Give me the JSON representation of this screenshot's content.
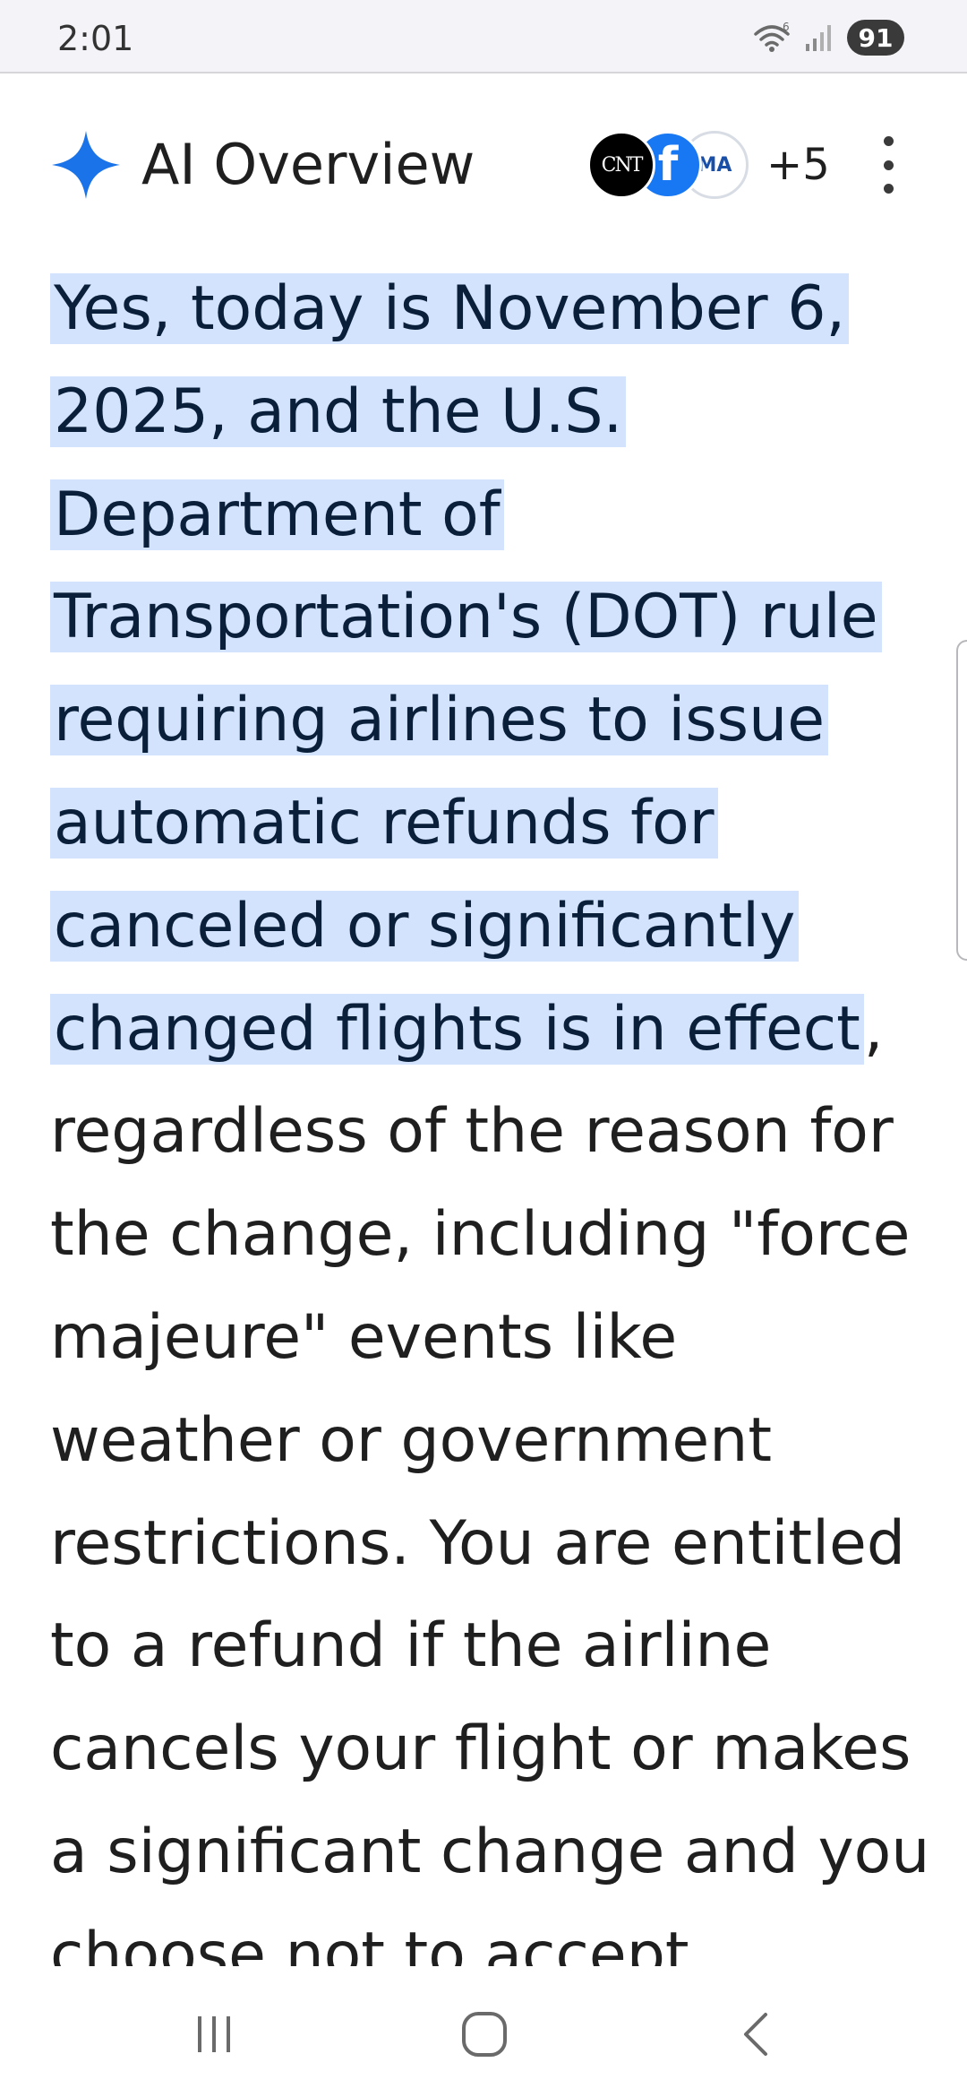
{
  "status_bar": {
    "time": "2:01",
    "battery": "91"
  },
  "overview": {
    "title": "AI Overview",
    "sources": {
      "cnt_label": "CNT",
      "facebook_label": "f",
      "ma_label": "MA",
      "more_count": "+5"
    },
    "highlighted_text": "Yes, today is November 6, 2025, and the U.S. Department of Transportation's (DOT) rule requiring airlines to issue automatic refunds for canceled or significantly changed flights is in effect",
    "body_text": ", regardless of the reason for the change, including \"force majeure\" events like weather or government restrictions. You are entitled to a refund if the airline cancels your flight or makes a significant change and you choose not to accept"
  },
  "navigation": {
    "icons": [
      "recents-icon",
      "home-icon",
      "back-icon"
    ]
  },
  "colors": {
    "highlight": "#d3e3fd",
    "sparkle": "#1a73e8",
    "facebook": "#1877f2"
  }
}
